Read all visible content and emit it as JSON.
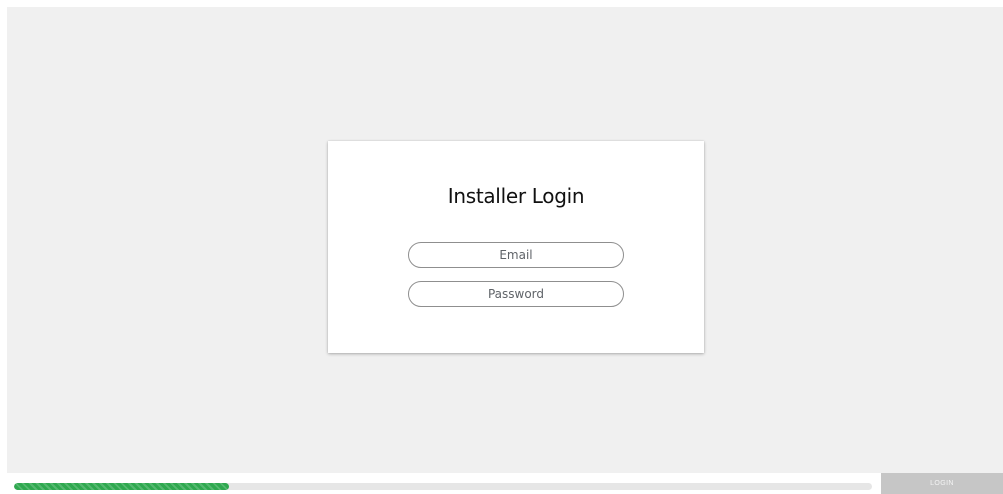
{
  "login_card": {
    "title": "Installer Login",
    "email_placeholder": "Email",
    "email_value": "",
    "password_placeholder": "Password",
    "password_value": ""
  },
  "footer": {
    "progress": 0.25,
    "progress_color": "#2fa84f",
    "login_label": "LOGIN",
    "login_enabled": false
  },
  "colors": {
    "page_background": "#f0f0f0",
    "card_background": "#ffffff",
    "login_button_background": "#c6c6c6"
  }
}
